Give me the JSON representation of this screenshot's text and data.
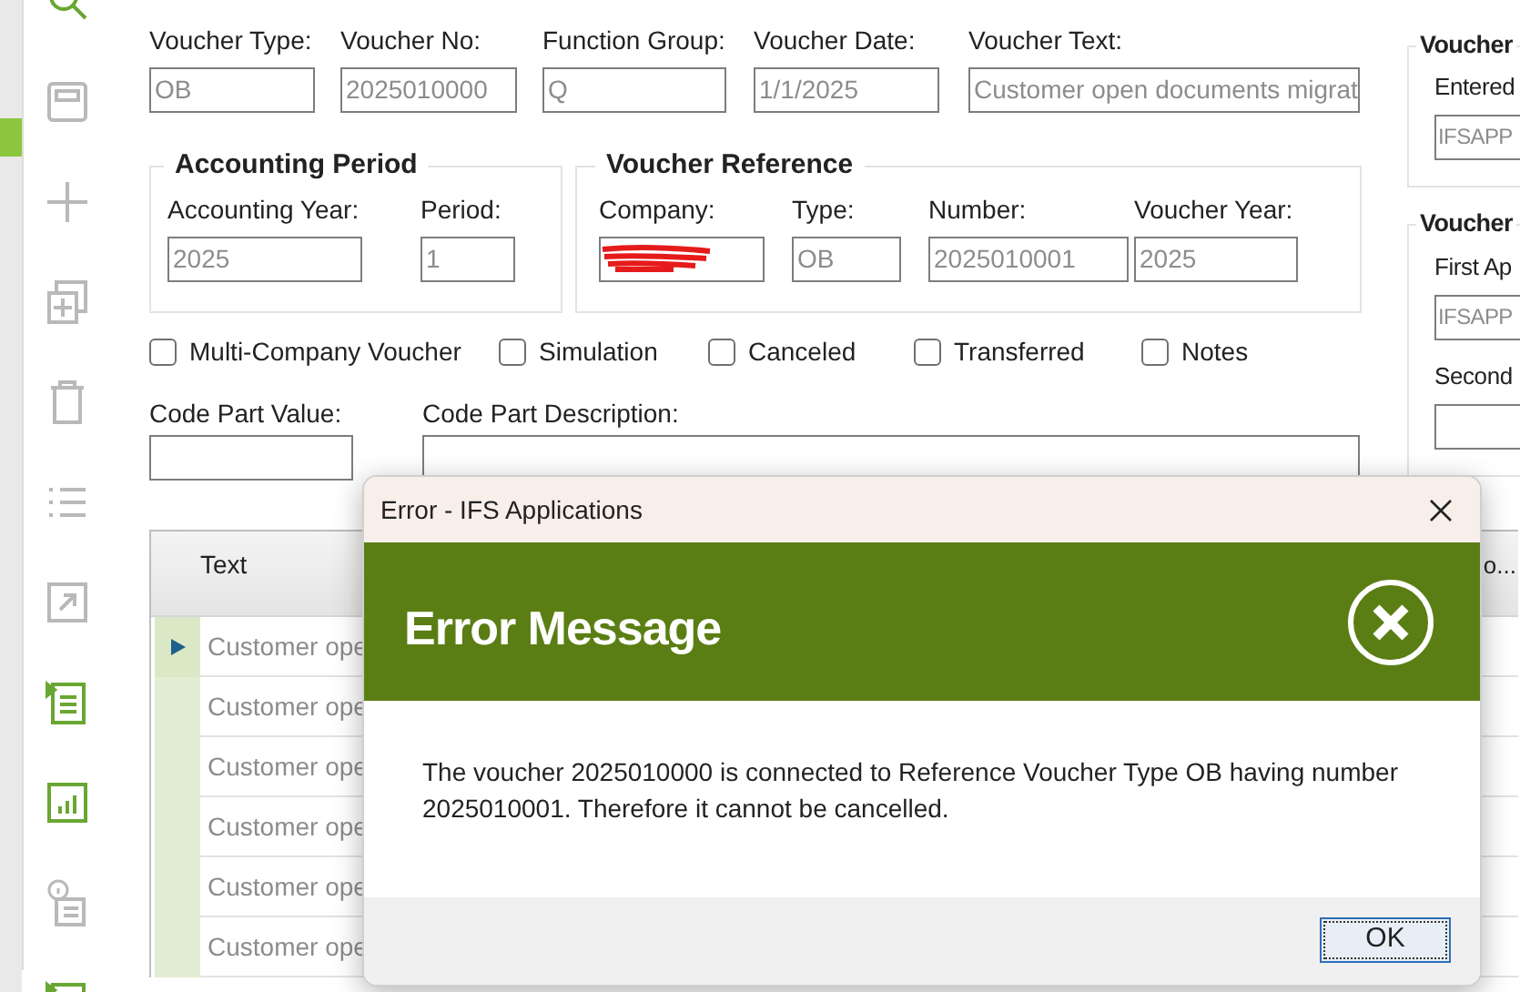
{
  "toolbar": [
    {
      "kind": "search",
      "disabled": false
    },
    {
      "kind": "save",
      "disabled": true
    },
    {
      "kind": "add",
      "disabled": true
    },
    {
      "kind": "duplicate",
      "disabled": true
    },
    {
      "kind": "delete",
      "disabled": true
    },
    {
      "kind": "list",
      "disabled": true
    },
    {
      "kind": "open",
      "disabled": true
    },
    {
      "kind": "details",
      "disabled": false
    },
    {
      "kind": "chart",
      "disabled": false
    },
    {
      "kind": "info",
      "disabled": true
    },
    {
      "kind": "details",
      "disabled": false
    }
  ],
  "header_fields": [
    {
      "label": "Voucher Type:",
      "value": "OB"
    },
    {
      "label": "Voucher No:",
      "value": "2025010000"
    },
    {
      "label": "Function Group:",
      "value": "Q"
    },
    {
      "label": "Voucher Date:",
      "value": "1/1/2025"
    },
    {
      "label": "Voucher Text:",
      "value": "Customer open documents migrat"
    }
  ],
  "accounting_period": {
    "title": "Accounting Period",
    "fields": [
      {
        "label": "Accounting Year:",
        "value": "2025"
      },
      {
        "label": "Period:",
        "value": "1"
      }
    ]
  },
  "voucher_reference": {
    "title": "Voucher Reference",
    "fields": [
      {
        "label": "Company:",
        "kind": "redacted"
      },
      {
        "label": "Type:",
        "value": "OB",
        "kind": "text"
      },
      {
        "label": "Number:",
        "value": "2025010001",
        "kind": "text"
      },
      {
        "label": "Voucher Year:",
        "value": "2025",
        "kind": "text"
      }
    ]
  },
  "checkboxes": [
    {
      "label": "Multi-Company Voucher",
      "checked": false
    },
    {
      "label": "Simulation",
      "checked": false
    },
    {
      "label": "Canceled",
      "checked": false
    },
    {
      "label": "Transferred",
      "checked": false
    },
    {
      "label": "Notes",
      "checked": false
    }
  ],
  "code_part": [
    {
      "label": "Code Part Value:"
    },
    {
      "label": "Code Part Description:"
    }
  ],
  "side_panel": [
    {
      "title": "Voucher",
      "fields": [
        {
          "label": "Entered",
          "value": "IFSAPP"
        }
      ]
    },
    {
      "title": "Voucher",
      "fields": [
        {
          "label": "First Ap",
          "value": "IFSAPP"
        },
        {
          "label": "Second"
        }
      ]
    }
  ],
  "table": {
    "columns": [
      {
        "label": "Text"
      },
      {
        "label": "o..."
      }
    ],
    "rows": [
      {
        "text": "Customer ope",
        "selected": true
      },
      {
        "text": "Customer ope",
        "selected": false
      },
      {
        "text": "Customer ope",
        "selected": false
      },
      {
        "text": "Customer ope",
        "selected": false
      },
      {
        "text": "Customer ope",
        "selected": false
      },
      {
        "text": "Customer ope",
        "selected": false
      }
    ]
  },
  "dialog": {
    "title": "Error - IFS Applications",
    "heading": "Error Message",
    "message": "The voucher 2025010000 is connected to Reference Voucher Type OB having number 2025010001. Therefore it cannot be cancelled.",
    "buttons": [
      "OK"
    ]
  }
}
